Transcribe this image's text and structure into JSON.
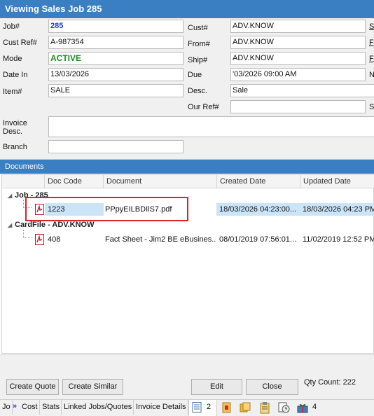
{
  "window": {
    "title": "Viewing Sales Job 285"
  },
  "header": {
    "job_label": "Job#",
    "job_value": "285",
    "custref_label": "Cust Ref#",
    "custref_value": "A-987354",
    "mode_label": "Mode",
    "mode_value": "ACTIVE",
    "datein_label": "Date In",
    "datein_value": "13/03/2026",
    "item_label": "Item#",
    "item_value": "SALE",
    "cust_label": "Cust#",
    "cust_value": "ADV.KNOW",
    "from_label": "From#",
    "from_value": "ADV.KNOW",
    "ship_label": "Ship#",
    "ship_value": "ADV.KNOW",
    "due_label": "Due",
    "due_value": "'03/2026 09:00 AM",
    "desc_label": "Desc.",
    "desc_value": "Sale",
    "ourref_label": "Our Ref#",
    "ourref_value": "",
    "invoice_desc_label_1": "Invoice",
    "invoice_desc_label_2": "Desc.",
    "invoice_desc_value": "",
    "branch_label": "Branch",
    "branch_value": "",
    "right_edge_labels": [
      "S",
      "F",
      "F",
      "N",
      "",
      "S"
    ]
  },
  "documents": {
    "section_title": "Documents",
    "columns": [
      "Doc Code",
      "Document",
      "Created Date",
      "Updated Date"
    ],
    "groups": [
      {
        "label": "Job - 285",
        "rows": [
          {
            "doc_code": "1223",
            "document": "PPpyEILBDIlS7.pdf",
            "created": "18/03/2026 04:23:00...",
            "updated": "18/03/2026 04:23 PM",
            "icon": "pdf-icon"
          }
        ]
      },
      {
        "label": "CardFile - ADV.KNOW",
        "rows": [
          {
            "doc_code": "408",
            "document": "Fact Sheet - Jim2 BE eBusines...",
            "created": "08/01/2019 07:56:01...",
            "updated": "11/02/2019 12:52 PM",
            "icon": "pdf-icon"
          }
        ]
      }
    ]
  },
  "buttons": {
    "create_quote": "Create Quote",
    "create_similar": "Create Similar",
    "edit": "Edit",
    "close": "Close",
    "qty_count": "Qty Count: 222"
  },
  "tabs": {
    "jo": "Jo",
    "cost": "Cost",
    "stats": "Stats",
    "linked": "Linked Jobs/Quotes",
    "invoice_details": "Invoice Details",
    "doc_count": "2",
    "attach_count": "4"
  },
  "colors": {
    "title_bar": "#3a7fc1",
    "selected_row": "#cce4f7",
    "highlight_box": "#d9232a",
    "active_mode": "#1e8c1e",
    "job_number": "#1a3ecf"
  }
}
